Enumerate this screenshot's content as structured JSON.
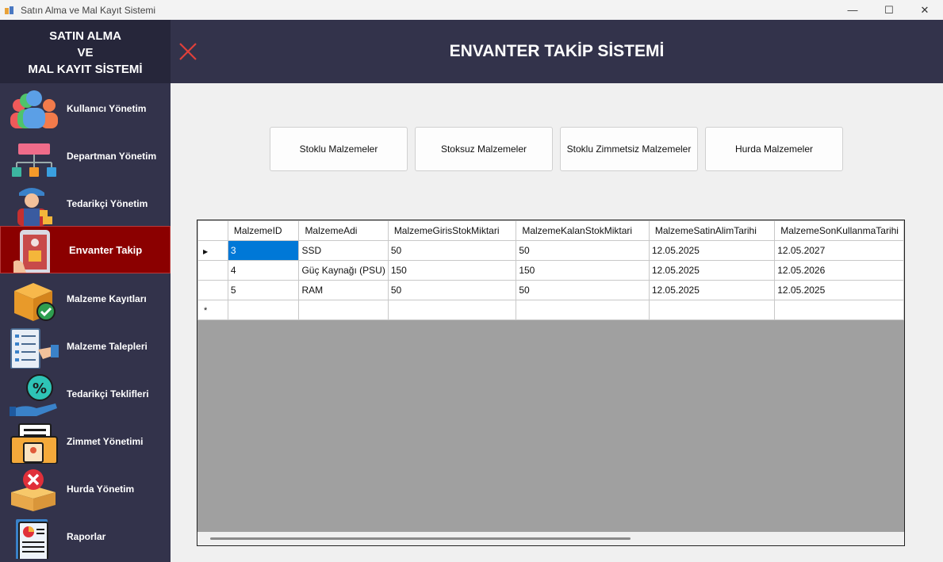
{
  "window": {
    "title": "Satın Alma ve Mal Kayıt Sistemi",
    "minimize": "—",
    "maximize": "☐",
    "close": "✕"
  },
  "sidebar": {
    "brand_line1": "SATIN ALMA",
    "brand_line2": "VE",
    "brand_line3": "MAL KAYIT SİSTEMİ",
    "items": [
      {
        "label": "Kullanıcı Yönetim",
        "icon": "users-icon"
      },
      {
        "label": "Departman Yönetim",
        "icon": "org-chart-icon"
      },
      {
        "label": "Tedarikçi Yönetim",
        "icon": "delivery-person-icon"
      },
      {
        "label": "Envanter Takip",
        "icon": "inventory-tablet-icon",
        "active": true
      },
      {
        "label": "Malzeme Kayıtları",
        "icon": "box-check-icon"
      },
      {
        "label": "Malzeme Talepleri",
        "icon": "request-list-icon"
      },
      {
        "label": "Tedarikçi Teklifleri",
        "icon": "discount-offer-icon"
      },
      {
        "label": "Zimmet Yönetimi",
        "icon": "assignment-folder-icon"
      },
      {
        "label": "Hurda Yönetim",
        "icon": "scrap-box-icon"
      },
      {
        "label": "Raporlar",
        "icon": "report-icon"
      }
    ]
  },
  "header": {
    "title": "ENVANTER TAKİP SİSTEMİ"
  },
  "filters": {
    "stocked": "Stoklu Malzemeler",
    "unstocked": "Stoksuz Malzemeler",
    "stocked_unassigned": "Stoklu Zimmetsiz Malzemeler",
    "scrap": "Hurda Malzemeler"
  },
  "grid": {
    "columns": [
      "MalzemeID",
      "MalzemeAdi",
      "MalzemeGirisStokMiktari",
      "MalzemeKalanStokMiktari",
      "MalzemeSatinAlimTarihi",
      "MalzemeSonKullanmaTarihi"
    ],
    "rows": [
      [
        "3",
        "SSD",
        "50",
        "50",
        "12.05.2025",
        "12.05.2027"
      ],
      [
        "4",
        "Güç Kaynağı (PSU)",
        "150",
        "150",
        "12.05.2025",
        "12.05.2026"
      ],
      [
        "5",
        "RAM",
        "50",
        "50",
        "12.05.2025",
        "12.05.2025"
      ]
    ],
    "current_row_marker": "▶",
    "new_row_marker": "*"
  }
}
